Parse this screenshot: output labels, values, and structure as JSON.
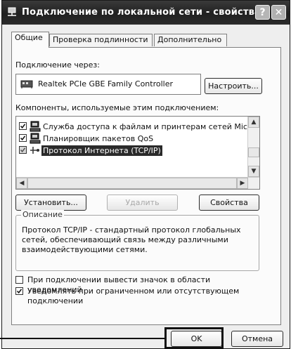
{
  "window": {
    "title": "Подключение по локальной сети - свойства",
    "help_label": "?",
    "close_label": "✕"
  },
  "tabs": [
    {
      "label": "Общие",
      "active": true
    },
    {
      "label": "Проверка подлинности",
      "active": false
    },
    {
      "label": "Дополнительно",
      "active": false
    }
  ],
  "connect_via": {
    "label": "Подключение через:",
    "adapter": "Realtek PCIe GBE Family Controller",
    "configure_button": "Настроить..."
  },
  "components": {
    "label": "Компоненты, используемые этим подключением:",
    "items": [
      {
        "label": "Служба доступа к файлам и принтерам сетей Micro",
        "checked": true,
        "icon": "service-icon",
        "selected": false
      },
      {
        "label": "Планировщик пакетов QoS",
        "checked": true,
        "icon": "scheduler-icon",
        "selected": false
      },
      {
        "label": "Протокол Интернета (TCP/IP)",
        "checked": true,
        "icon": "protocol-icon",
        "selected": true
      }
    ]
  },
  "actions": {
    "install": "Установить...",
    "remove": "Удалить",
    "properties": "Свойства"
  },
  "description": {
    "legend": "Описание",
    "text": "Протокол TCP/IP - стандартный протокол глобальных сетей, обеспечивающий связь между различными взаимодействующими сетями."
  },
  "options": [
    {
      "label": "При подключении вывести значок в области уведомлений",
      "checked": false
    },
    {
      "label": "Уведомлять при ограниченном или отсутствующем подключении",
      "checked": true
    }
  ],
  "footer": {
    "ok": "OK",
    "cancel": "Отмена"
  },
  "colors": {
    "title_bar": "#2a2a2a",
    "selection": "#2a2a2a",
    "dialog_bg": "#eeeeee"
  }
}
